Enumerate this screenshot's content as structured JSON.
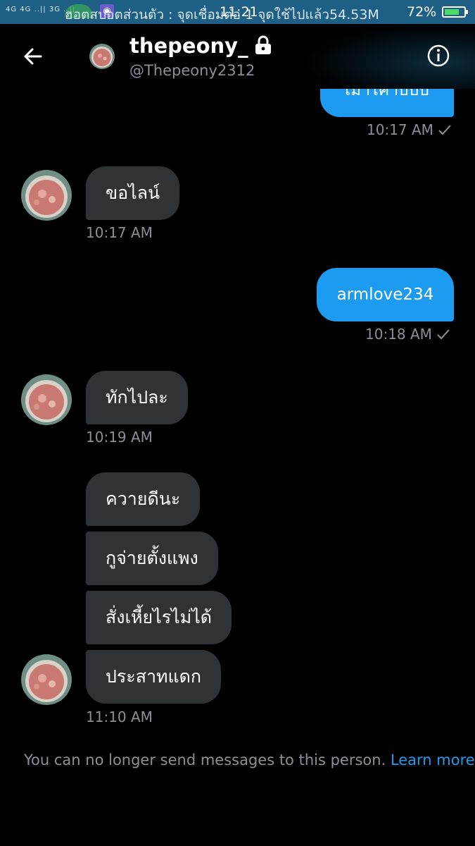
{
  "status_bar": {
    "signal_text": "4G 4G ..|| 3G ..||",
    "ticker": "ฮอตสปอตส่วนตัว : จุดเชื่อมต่อ 1 จุดใช้ไปแล้ว54.53M",
    "clock": "11:21",
    "battery": "72%"
  },
  "header": {
    "name": "thepeony_",
    "handle": "@Thepeony2312"
  },
  "messages": {
    "m0_text": "เมาไค่าบบบ",
    "m0_time": "10:17 AM",
    "m1_text": "ขอไลน์",
    "m1_time": "10:17 AM",
    "m2_text": "armlove234",
    "m2_time": "10:18 AM",
    "m3_text": "ทักไปละ",
    "m3_time": "10:19 AM",
    "m4_text": "ควายดีนะ",
    "m5_text": "กูจ่ายตั้งแพง",
    "m6_text": "สั่งเหี้ยไรไม่ได้",
    "m7_text": "ประสาทแดก",
    "m7_time": "11:10 AM"
  },
  "footer": {
    "notice": "You can no longer send messages to this person.",
    "link": "Learn more"
  },
  "colors": {
    "accent": "#1d9bf0",
    "incoming_bubble": "#2f3336",
    "background": "#000000"
  }
}
